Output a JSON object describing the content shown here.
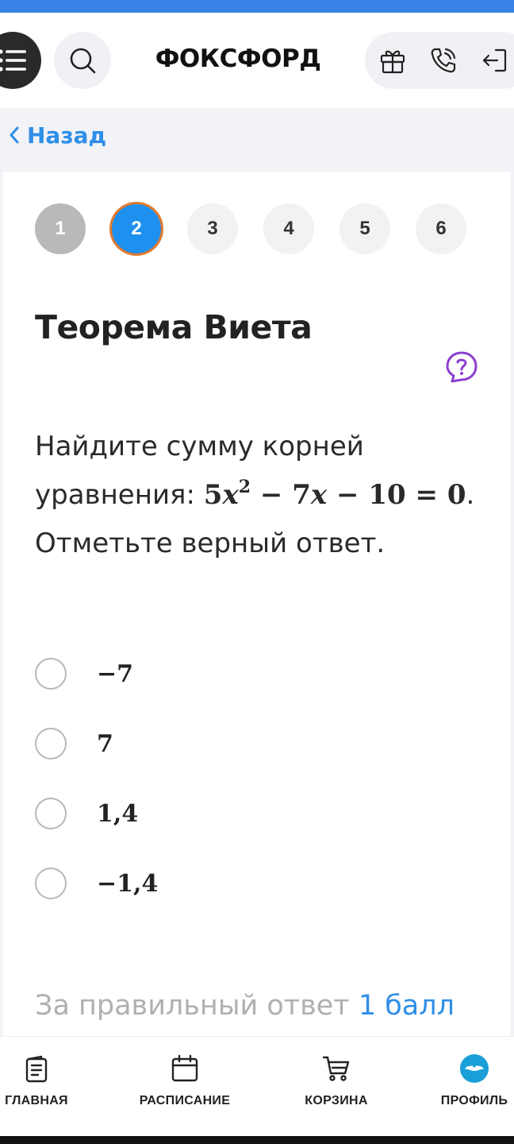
{
  "header": {
    "logo": "ФОКСФОРД"
  },
  "nav": {
    "back_label": "Назад"
  },
  "steps": [
    {
      "label": "1",
      "state": "done"
    },
    {
      "label": "2",
      "state": "active"
    },
    {
      "label": "3",
      "state": "pending"
    },
    {
      "label": "4",
      "state": "pending"
    },
    {
      "label": "5",
      "state": "pending"
    },
    {
      "label": "6",
      "state": "pending"
    }
  ],
  "task": {
    "title": "Теорема Виета",
    "question_line1": "Найдите сумму корней",
    "question_line2_prefix": "уравнения: ",
    "question_line2_suffix": ".",
    "question_line3": "Отметьте верный ответ.",
    "equation": {
      "coef_a": "5",
      "var": "x",
      "exponent": "2",
      "op1": " − ",
      "coef_b": "7",
      "var_b": "x",
      "op2": " − ",
      "const": "10",
      "eq": " = ",
      "rhs": "0"
    }
  },
  "options": [
    {
      "label": "−7"
    },
    {
      "label": "7"
    },
    {
      "label": "1,4"
    },
    {
      "label": "−1,4"
    }
  ],
  "points": {
    "prefix": "За правильный ответ ",
    "value": "1 балл"
  },
  "tabbar": {
    "items": [
      {
        "label": "ГЛАВНАЯ"
      },
      {
        "label": "РАСПИСАНИЕ"
      },
      {
        "label": "КОРЗИНА"
      },
      {
        "label": "ПРОФИЛЬ"
      }
    ]
  },
  "colors": {
    "accent": "#2f8ee8",
    "active_step": "#1e90f0",
    "active_ring": "#e07a2e",
    "help_icon": "#8a3fd1"
  },
  "icons": {
    "menu": "list-menu-icon",
    "search": "search-icon",
    "gift": "gift-icon",
    "phone": "phone-icon",
    "logout": "logout-icon",
    "back": "chevron-left-icon",
    "help": "help-icon",
    "home": "home-document-icon",
    "schedule": "calendar-icon",
    "cart": "cart-icon",
    "profile": "avatar-icon"
  }
}
